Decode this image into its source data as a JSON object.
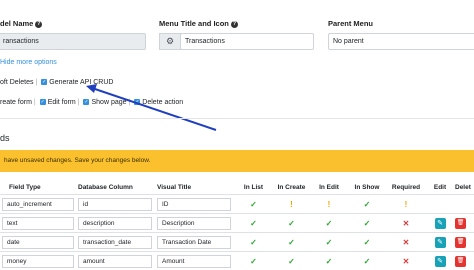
{
  "form": {
    "model_name_label": "del Name",
    "model_name_value": "ransactions",
    "menu_title_label": "Menu Title and Icon",
    "menu_icon": "gear-icon",
    "menu_title_value": "Transactions",
    "parent_menu_label": "Parent Menu",
    "parent_menu_value": "No parent",
    "hide_more_options": "Hide more options",
    "soft_deletes": "oft Deletes",
    "generate_api": "Generate API CRUD",
    "create_form": "reate form",
    "edit_form": "Edit form",
    "show_page": "Show page",
    "delete_action": "Delete action"
  },
  "section_title": "ds",
  "alert_text": "have unsaved changes. Save your changes below.",
  "table": {
    "headers": [
      "Field Type",
      "Database Column",
      "Visual Title",
      "In List",
      "In Create",
      "In Edit",
      "In Show",
      "Required",
      "Edit",
      "Delet"
    ],
    "rows": [
      {
        "type": "auto_increment",
        "column": "id",
        "title": "ID",
        "flags": [
          "ok",
          "warn",
          "warn",
          "ok",
          "warn"
        ],
        "editable": false
      },
      {
        "type": "text",
        "column": "description",
        "title": "Description",
        "flags": [
          "ok",
          "ok",
          "ok",
          "ok",
          "no"
        ],
        "editable": true
      },
      {
        "type": "date",
        "column": "transaction_date",
        "title": "Transaction Date",
        "flags": [
          "ok",
          "ok",
          "ok",
          "ok",
          "no"
        ],
        "editable": true
      },
      {
        "type": "money",
        "column": "amount",
        "title": "Amount",
        "flags": [
          "ok",
          "ok",
          "ok",
          "ok",
          "no"
        ],
        "editable": true
      }
    ]
  },
  "colors": {
    "accent": "#3490dc",
    "alert": "#fbc02d",
    "check": "#2aa52e",
    "cross": "#d63a3a",
    "warning": "#f0a500",
    "edit": "#17a2b8",
    "delete": "#e3342f",
    "arrow": "#1f3fbf"
  }
}
